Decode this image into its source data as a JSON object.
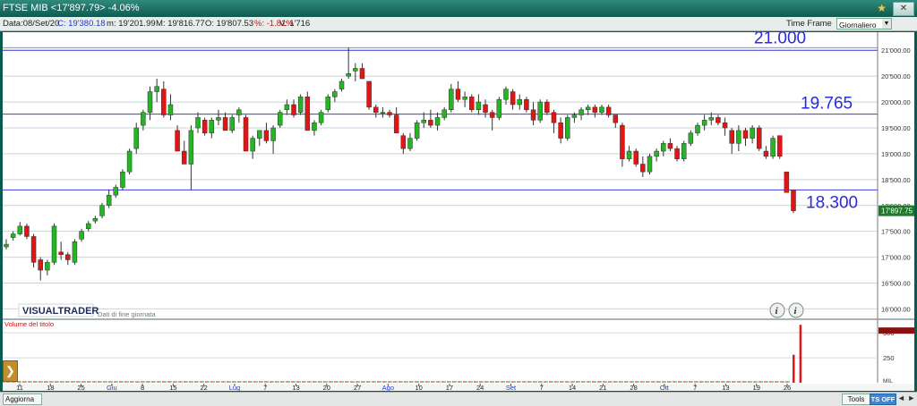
{
  "window": {
    "title": "FTSE MIB <17'897.79> -4.06%",
    "close_label": "✕"
  },
  "infobar": {
    "date": "Data:08/Set/20",
    "close": "C: 19'380.18",
    "min": "m: 19'201.99",
    "max": "M: 19'816.77",
    "open": "O: 19'807.53",
    "pct": "%: -1.81%",
    "volume": "V: 1'716",
    "timeframe_label": "Time Frame",
    "timeframe_value": "Giornaliero"
  },
  "bottombar": {
    "aggiorna_label": "Aggiorna",
    "tools_label": "Tools",
    "tsoff_label": "TS OFF",
    "arrows": "◄ ►"
  },
  "watermark": {
    "logo": "VISUALTRADER",
    "caption": "Dati di fine giornata"
  },
  "colors": {
    "up": "#22b622",
    "down": "#e01515",
    "level_line": "#3b3bd9",
    "label": "#2a2ae0",
    "price_tag": "#1e7a2a",
    "chart_bg": "#ffffff"
  },
  "icons": {
    "info1": "info-icon",
    "info2": "info-icon",
    "left_toggle": "chevron-right-icon"
  },
  "chart_data": {
    "type": "candlestick",
    "price_ylim": [
      15800,
      21350
    ],
    "yticks": [
      "16'000.00",
      "16'500.00",
      "17'000.00",
      "17'500.00",
      "18'000.00",
      "18'500.00",
      "19'000.00",
      "19'500.00",
      "20'000.00",
      "20'500.00",
      "21'000.00"
    ],
    "ytick_values": [
      16000,
      16500,
      17000,
      17500,
      18000,
      18500,
      19000,
      19500,
      20000,
      20500,
      21000
    ],
    "xticks": [
      "11",
      "18",
      "25",
      "Giu",
      "8",
      "15",
      "22",
      "Lug",
      "7",
      "13",
      "20",
      "27",
      "Ago",
      "10",
      "17",
      "24",
      "Set",
      "7",
      "14",
      "21",
      "28",
      "Ott",
      "7",
      "13",
      "19",
      "26"
    ],
    "xtick_months": [
      "Giu",
      "Lug",
      "Ago",
      "Set",
      "Ott"
    ],
    "current_price_label": "17'897.75",
    "levels": [
      {
        "value": 21000,
        "label": "21.000"
      },
      {
        "value": 19765,
        "label": "19.765"
      },
      {
        "value": 18300,
        "label": "18.300"
      }
    ],
    "candles": [
      [
        17200,
        17350,
        17150,
        17250
      ],
      [
        17380,
        17500,
        17320,
        17450
      ],
      [
        17450,
        17680,
        17420,
        17600
      ],
      [
        17600,
        17650,
        17350,
        17400
      ],
      [
        17400,
        17450,
        16800,
        16900
      ],
      [
        16950,
        17000,
        16550,
        16750
      ],
      [
        16750,
        16950,
        16650,
        16900
      ],
      [
        16900,
        17650,
        16850,
        17600
      ],
      [
        17100,
        17300,
        16950,
        17050
      ],
      [
        17050,
        17100,
        16850,
        16950
      ],
      [
        16900,
        17350,
        16850,
        17300
      ],
      [
        17350,
        17550,
        17300,
        17500
      ],
      [
        17550,
        17700,
        17500,
        17650
      ],
      [
        17700,
        17800,
        17650,
        17750
      ],
      [
        17800,
        18050,
        17750,
        18000
      ],
      [
        18000,
        18300,
        17950,
        18200
      ],
      [
        18200,
        18400,
        18150,
        18350
      ],
      [
        18350,
        18700,
        18300,
        18650
      ],
      [
        18650,
        19100,
        18600,
        19050
      ],
      [
        19100,
        19600,
        19000,
        19500
      ],
      [
        19550,
        19850,
        19450,
        19800
      ],
      [
        19800,
        20300,
        19650,
        20200
      ],
      [
        20200,
        20450,
        20000,
        20300
      ],
      [
        20250,
        20400,
        19700,
        19750
      ],
      [
        19750,
        20150,
        19650,
        19950
      ],
      [
        19450,
        19550,
        19150,
        19050
      ],
      [
        19050,
        19250,
        18950,
        18800
      ],
      [
        18800,
        19550,
        18300,
        19450
      ],
      [
        19500,
        19800,
        19400,
        19700
      ],
      [
        19650,
        19700,
        19350,
        19400
      ],
      [
        19400,
        19700,
        19300,
        19650
      ],
      [
        19650,
        19850,
        19550,
        19700
      ],
      [
        19700,
        19800,
        19500,
        19450
      ],
      [
        19450,
        19750,
        19400,
        19700
      ],
      [
        19750,
        19900,
        19600,
        19850
      ],
      [
        19700,
        19750,
        19250,
        19050
      ],
      [
        19050,
        19350,
        18900,
        19300
      ],
      [
        19300,
        19450,
        19150,
        19450
      ],
      [
        19450,
        19600,
        19200,
        19250
      ],
      [
        19250,
        19550,
        19000,
        19500
      ],
      [
        19550,
        19850,
        19500,
        19800
      ],
      [
        19850,
        20050,
        19750,
        19950
      ],
      [
        19950,
        20050,
        19700,
        19750
      ],
      [
        19800,
        20150,
        19750,
        20100
      ],
      [
        20100,
        20200,
        19500,
        19450
      ],
      [
        19450,
        19650,
        19350,
        19600
      ],
      [
        19600,
        19850,
        19550,
        19800
      ],
      [
        19850,
        20150,
        19800,
        20100
      ],
      [
        20100,
        20250,
        20000,
        20200
      ],
      [
        20250,
        20450,
        20200,
        20400
      ],
      [
        20500,
        21050,
        20450,
        20550
      ],
      [
        20600,
        20750,
        20400,
        20650
      ],
      [
        20650,
        20750,
        20500,
        20450
      ],
      [
        20400,
        20350,
        19850,
        19900
      ],
      [
        19900,
        19950,
        19700,
        19800
      ],
      [
        19800,
        19900,
        19700,
        19800
      ],
      [
        19800,
        19850,
        19700,
        19750
      ],
      [
        19750,
        19900,
        19600,
        19400
      ],
      [
        19350,
        19400,
        19000,
        19100
      ],
      [
        19100,
        19400,
        19050,
        19300
      ],
      [
        19300,
        19650,
        19250,
        19600
      ],
      [
        19600,
        19800,
        19500,
        19650
      ],
      [
        19650,
        19850,
        19500,
        19550
      ],
      [
        19550,
        19800,
        19450,
        19700
      ],
      [
        19700,
        19900,
        19650,
        19850
      ],
      [
        19850,
        20350,
        19800,
        20250
      ],
      [
        20250,
        20400,
        20000,
        20050
      ],
      [
        20050,
        20200,
        19900,
        20100
      ],
      [
        20100,
        20150,
        19800,
        19850
      ],
      [
        19850,
        20150,
        19750,
        20000
      ],
      [
        19950,
        20050,
        19700,
        19800
      ],
      [
        19800,
        19850,
        19450,
        19700
      ],
      [
        19700,
        20100,
        19650,
        20050
      ],
      [
        20050,
        20300,
        19950,
        20250
      ],
      [
        20200,
        20250,
        19850,
        19950
      ],
      [
        19950,
        20150,
        19850,
        20050
      ],
      [
        20050,
        20100,
        19800,
        19850
      ],
      [
        19850,
        20000,
        19550,
        19650
      ],
      [
        19650,
        20050,
        19600,
        20000
      ],
      [
        20000,
        20050,
        19750,
        19800
      ],
      [
        19800,
        19850,
        19400,
        19600
      ],
      [
        19600,
        19700,
        19200,
        19300
      ],
      [
        19300,
        19750,
        19250,
        19700
      ],
      [
        19700,
        19800,
        19600,
        19750
      ],
      [
        19750,
        19900,
        19650,
        19850
      ],
      [
        19850,
        19950,
        19750,
        19900
      ],
      [
        19900,
        19950,
        19700,
        19800
      ],
      [
        19800,
        19950,
        19750,
        19900
      ],
      [
        19900,
        19950,
        19700,
        19750
      ],
      [
        19750,
        19700,
        19500,
        19600
      ],
      [
        19550,
        19600,
        18750,
        18900
      ],
      [
        18900,
        19150,
        18850,
        19050
      ],
      [
        19050,
        19100,
        18750,
        18800
      ],
      [
        18800,
        18950,
        18550,
        18650
      ],
      [
        18650,
        19000,
        18600,
        18950
      ],
      [
        18950,
        19100,
        18850,
        19050
      ],
      [
        19050,
        19250,
        18950,
        19200
      ],
      [
        19200,
        19300,
        19050,
        19100
      ],
      [
        19100,
        19150,
        18850,
        18900
      ],
      [
        18900,
        19250,
        18850,
        19200
      ],
      [
        19200,
        19450,
        19150,
        19400
      ],
      [
        19400,
        19600,
        19350,
        19550
      ],
      [
        19550,
        19750,
        19450,
        19650
      ],
      [
        19650,
        19800,
        19550,
        19700
      ],
      [
        19700,
        19750,
        19550,
        19600
      ],
      [
        19600,
        19700,
        19350,
        19500
      ],
      [
        19450,
        19500,
        19000,
        19200
      ],
      [
        19200,
        19550,
        19050,
        19450
      ],
      [
        19450,
        19500,
        19150,
        19300
      ],
      [
        19300,
        19550,
        19200,
        19500
      ],
      [
        19500,
        19550,
        19050,
        19100
      ],
      [
        19050,
        19150,
        18900,
        18950
      ],
      [
        18950,
        19350,
        18900,
        19300
      ],
      [
        19350,
        19300,
        18900,
        18950
      ],
      [
        18650,
        18600,
        18300,
        18250
      ],
      [
        18300,
        18300,
        17850,
        17898
      ]
    ],
    "volume_ylim": [
      0,
      600
    ],
    "volume_yticks": [
      "250",
      "500"
    ],
    "volume_ytick_values": [
      250,
      500
    ],
    "volume_title": "Volume del titolo",
    "volume_bars": [
      {
        "index": 115,
        "value": 280
      },
      {
        "index": 116,
        "value": 580
      }
    ],
    "volume_current_label": "500",
    "volume_min_label": "MIL"
  }
}
